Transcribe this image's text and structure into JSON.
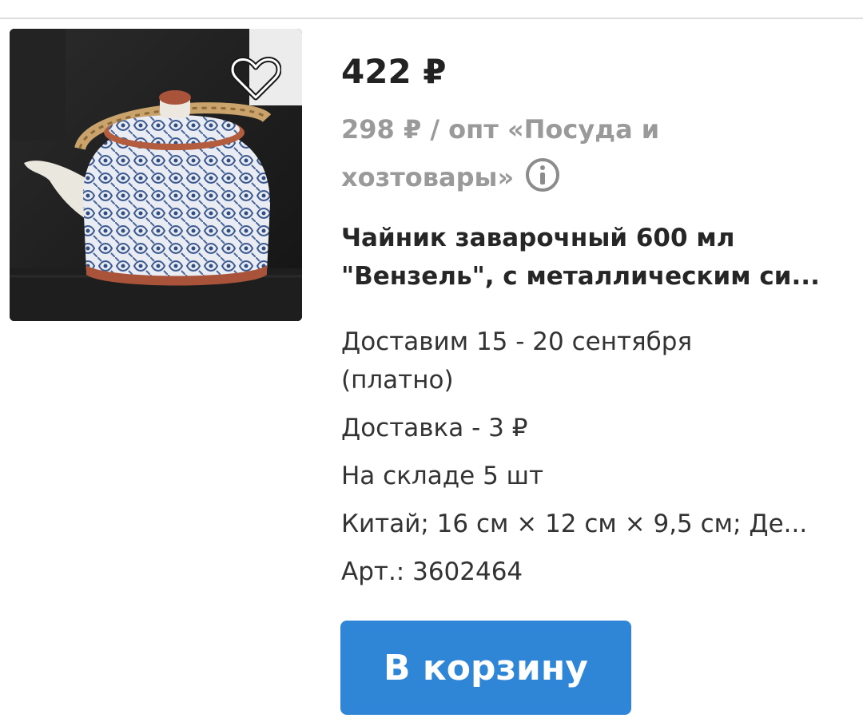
{
  "product": {
    "price": "422 ₽",
    "wholesale_price_line1": "298 ₽ / опт «Посуда и",
    "wholesale_price_line2": "хозтовары»",
    "title_line1": "Чайник заварочный 600 мл",
    "title_line2": "\"Вензель\", с металлическим си...",
    "delivery_date_line1": "Доставим 15 - 20 сентября",
    "delivery_date_line2": "(платно)",
    "delivery_cost": "Доставка - 3 ₽",
    "stock": "На складе 5 шт",
    "specs": "Китай; 16 см × 12 см × 9,5 см; Де...",
    "article": "Арт.: 3602464",
    "add_to_cart_label": "В корзину"
  },
  "icons": {
    "favorite": "heart-icon",
    "info": "info-icon"
  },
  "colors": {
    "button_blue": "#2f86d6",
    "wholesale_gray": "#9a9a9a"
  }
}
